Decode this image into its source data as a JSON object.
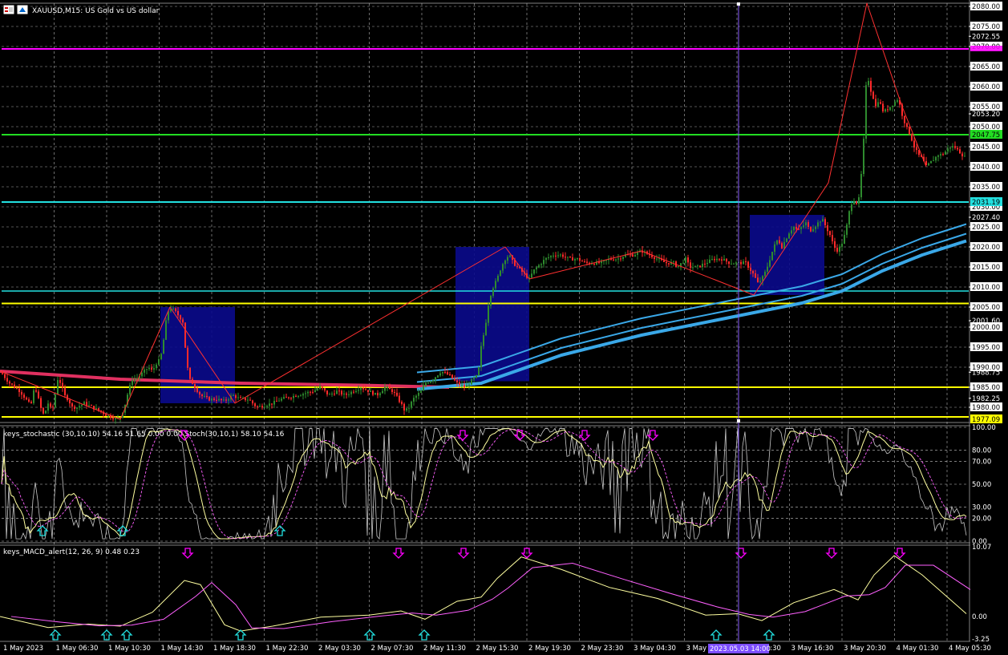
{
  "chart_window": {
    "title": "XAUUSD,M15:  US Gold vs US dollar",
    "symbol": "XAUUSD",
    "timeframe": "M15",
    "description": "US Gold vs US dollar"
  },
  "colors": {
    "background": "#000000",
    "grid": "#c8c8c8",
    "bull_candle": "#2e8b2e",
    "bear_candle": "#ff2a2a",
    "zigzag": "#ff3030",
    "zone": "#0a0a8c",
    "ma_slow": "#e03060",
    "ma_blue": "#3aa8e8",
    "level_magenta": "#ff00ff",
    "level_green": "#22dd22",
    "level_cyan": "#22e0e0",
    "level_yellow": "#ffff00",
    "stoch_main": "#c8c8c8",
    "stoch_signal": "#ffffa0",
    "stoch_dash": "#ff60ff",
    "macd_main": "#ffffa0",
    "macd_signal": "#ff60ff",
    "arrow_up": "#22e0e0",
    "arrow_down": "#ff00ff",
    "crosshair": "#8a5cff"
  },
  "price_axis": {
    "labels": [
      "2080.00",
      "2075.00",
      "2072.55",
      "2070.00",
      "2065.00",
      "2060.00",
      "2055.00",
      "2053.20",
      "2050.00",
      "2045.00",
      "2040.00",
      "2035.00",
      "2030.00",
      "2027.40",
      "2025.00",
      "2020.00",
      "2015.00",
      "2010.00",
      "2005.00",
      "2001.60",
      "2000.00",
      "1995.00",
      "1990.00",
      "1988.75",
      "1985.00",
      "1982.25",
      "1980.00"
    ],
    "current_price": "1977.09",
    "green_level_label": "2047.75",
    "cyan_level_label": "2031.19",
    "magenta_level": "2069.4",
    "yellow_level": "2005.9"
  },
  "stoch_panel": {
    "title": "keys_stochastic (30,10,10) 54.16 51.65 0.00 0.00  Stoch(30,10,1) 58.10 54.16",
    "levels": [
      "100.00",
      "80.00",
      "70.00",
      "50.00",
      "30.00",
      "20.00",
      "0.00"
    ]
  },
  "macd_panel": {
    "title": "keys_MACD_alert(12, 26, 9) 0.48 0.23",
    "levels": [
      "10.07",
      "0.00",
      "-3.25"
    ]
  },
  "time_axis": {
    "labels": [
      "1 May 2023",
      "1 May 06:30",
      "1 May 10:30",
      "1 May 14:30",
      "1 May 18:30",
      "1 May 22:30",
      "2 May 03:30",
      "2 May 07:30",
      "2 May 11:30",
      "2 May 15:30",
      "2 May 19:30",
      "2 May 23:30",
      "3 May 04:30",
      "3 May 08:30",
      "3 May 12:30",
      "3 May 16:30",
      "3 May 20:30",
      "4 May 01:30",
      "4 May 05:30"
    ],
    "crosshair_label": "2023.05.03 14:00"
  },
  "chart_data": {
    "type": "candlestick",
    "title": "XAUUSD,M15:  US Gold vs US dollar",
    "y_range": [
      1977.0,
      2080.8
    ],
    "path": [
      [
        0,
        1989
      ],
      [
        12,
        1986
      ],
      [
        25,
        1984
      ],
      [
        36,
        1981
      ],
      [
        38,
        1979
      ],
      [
        40,
        1983
      ],
      [
        44,
        1985
      ],
      [
        48,
        1982
      ],
      [
        52,
        1979
      ],
      [
        55,
        1978
      ],
      [
        60,
        1981
      ],
      [
        65,
        1979
      ],
      [
        68,
        1982
      ],
      [
        72,
        1987
      ],
      [
        76,
        1986
      ],
      [
        80,
        1983
      ],
      [
        85,
        1982
      ],
      [
        90,
        1980
      ],
      [
        96,
        1980
      ],
      [
        105,
        1981
      ],
      [
        115,
        1980
      ],
      [
        125,
        1979
      ],
      [
        133,
        1978
      ],
      [
        140,
        1977.5
      ],
      [
        145,
        1977
      ],
      [
        150,
        1977.5
      ],
      [
        155,
        1980
      ],
      [
        160,
        1984
      ],
      [
        165,
        1987
      ],
      [
        170,
        1987
      ],
      [
        175,
        1988
      ],
      [
        180,
        1989
      ],
      [
        185,
        1990
      ],
      [
        190,
        1989
      ],
      [
        195,
        1991
      ],
      [
        200,
        1992
      ],
      [
        205,
        1998
      ],
      [
        208,
        2003
      ],
      [
        212,
        2005
      ],
      [
        218,
        2004
      ],
      [
        222,
        2003
      ],
      [
        226,
        2002
      ],
      [
        229,
        2001
      ],
      [
        231,
        1995
      ],
      [
        233,
        1991
      ],
      [
        236,
        1987
      ],
      [
        240,
        1986
      ],
      [
        250,
        1983
      ],
      [
        260,
        1982
      ],
      [
        270,
        1982
      ],
      [
        280,
        1981.5
      ],
      [
        290,
        1983
      ],
      [
        300,
        1982
      ],
      [
        310,
        1982
      ],
      [
        320,
        1980
      ],
      [
        330,
        1980.5
      ],
      [
        340,
        1981
      ],
      [
        350,
        1982
      ],
      [
        360,
        1982.5
      ],
      [
        370,
        1983
      ],
      [
        380,
        1983.5
      ],
      [
        390,
        1984
      ],
      [
        400,
        1985
      ],
      [
        410,
        1983
      ],
      [
        420,
        1984
      ],
      [
        430,
        1983
      ],
      [
        440,
        1984
      ],
      [
        450,
        1985
      ],
      [
        460,
        1984
      ],
      [
        470,
        1983
      ],
      [
        480,
        1985
      ],
      [
        490,
        1984
      ],
      [
        500,
        1981
      ],
      [
        505,
        1979
      ],
      [
        510,
        1980
      ],
      [
        515,
        1982
      ],
      [
        520,
        1983
      ],
      [
        525,
        1984
      ],
      [
        530,
        1986
      ],
      [
        540,
        1987
      ],
      [
        550,
        1989
      ],
      [
        560,
        1988
      ],
      [
        570,
        1986
      ],
      [
        580,
        1985
      ],
      [
        590,
        1987
      ],
      [
        596,
        1988
      ],
      [
        600,
        1995
      ],
      [
        605,
        2000
      ],
      [
        610,
        2007
      ],
      [
        615,
        2010
      ],
      [
        620,
        2012
      ],
      [
        625,
        2015
      ],
      [
        630,
        2017
      ],
      [
        635,
        2018
      ],
      [
        640,
        2016
      ],
      [
        645,
        2015
      ],
      [
        650,
        2014
      ],
      [
        655,
        2013
      ],
      [
        660,
        2012
      ],
      [
        665,
        2014
      ],
      [
        670,
        2015
      ],
      [
        680,
        2017
      ],
      [
        690,
        2018
      ],
      [
        700,
        2018
      ],
      [
        710,
        2017
      ],
      [
        720,
        2017
      ],
      [
        730,
        2016
      ],
      [
        740,
        2016
      ],
      [
        750,
        2016
      ],
      [
        760,
        2017
      ],
      [
        770,
        2017
      ],
      [
        780,
        2018
      ],
      [
        790,
        2018
      ],
      [
        800,
        2019
      ],
      [
        810,
        2018
      ],
      [
        820,
        2017
      ],
      [
        830,
        2016
      ],
      [
        840,
        2016
      ],
      [
        845,
        2015
      ],
      [
        850,
        2016
      ],
      [
        855,
        2017
      ],
      [
        860,
        2015
      ],
      [
        870,
        2015
      ],
      [
        880,
        2016
      ],
      [
        890,
        2017
      ],
      [
        900,
        2017
      ],
      [
        910,
        2016
      ],
      [
        920,
        2016
      ],
      [
        930,
        2016
      ],
      [
        940,
        2013
      ],
      [
        945,
        2011
      ],
      [
        950,
        2012
      ],
      [
        955,
        2014
      ],
      [
        960,
        2017
      ],
      [
        965,
        2020
      ],
      [
        970,
        2022
      ],
      [
        975,
        2020
      ],
      [
        980,
        2022
      ],
      [
        985,
        2024
      ],
      [
        990,
        2025
      ],
      [
        995,
        2024
      ],
      [
        1000,
        2025
      ],
      [
        1005,
        2026
      ],
      [
        1010,
        2024
      ],
      [
        1015,
        2025
      ],
      [
        1020,
        2026
      ],
      [
        1025,
        2027
      ],
      [
        1030,
        2025
      ],
      [
        1035,
        2023
      ],
      [
        1040,
        2020
      ],
      [
        1045,
        2019
      ],
      [
        1050,
        2021
      ],
      [
        1055,
        2024
      ],
      [
        1058,
        2028
      ],
      [
        1062,
        2031
      ],
      [
        1066,
        2032
      ],
      [
        1070,
        2030
      ],
      [
        1075,
        2040
      ],
      [
        1078,
        2050
      ],
      [
        1081,
        2065
      ],
      [
        1084,
        2060
      ],
      [
        1088,
        2058
      ],
      [
        1092,
        2055
      ],
      [
        1096,
        2057
      ],
      [
        1100,
        2054
      ],
      [
        1105,
        2054
      ],
      [
        1110,
        2055
      ],
      [
        1115,
        2056
      ],
      [
        1120,
        2057
      ],
      [
        1125,
        2053
      ],
      [
        1130,
        2050
      ],
      [
        1135,
        2048
      ],
      [
        1140,
        2045
      ],
      [
        1145,
        2043
      ],
      [
        1150,
        2042
      ],
      [
        1155,
        2040
      ],
      [
        1160,
        2041
      ],
      [
        1165,
        2042
      ],
      [
        1170,
        2043
      ],
      [
        1175,
        2043
      ],
      [
        1180,
        2044
      ],
      [
        1185,
        2045
      ],
      [
        1190,
        2045
      ],
      [
        1195,
        2044
      ],
      [
        1200,
        2043
      ],
      [
        1205,
        2042
      ]
    ],
    "zigzag": [
      [
        0,
        1989
      ],
      [
        150,
        1977
      ],
      [
        212,
        2005
      ],
      [
        293,
        1981
      ],
      [
        630,
        2020
      ],
      [
        660,
        2012
      ],
      [
        800,
        2019
      ],
      [
        940,
        2008
      ],
      [
        1033,
        2036
      ],
      [
        1081,
        2080.8
      ],
      [
        1125,
        2055
      ],
      [
        1155,
        2040
      ]
    ],
    "zones": [
      [
        200,
        293,
        1981,
        2005
      ],
      [
        568,
        660,
        1986.5,
        2020
      ],
      [
        935,
        1028,
        2008,
        2028
      ]
    ],
    "ma_slow": [
      [
        0,
        1989
      ],
      [
        150,
        1987
      ],
      [
        300,
        1986
      ],
      [
        450,
        1985.5
      ],
      [
        560,
        1985
      ]
    ],
    "ma_blue": [
      [
        520,
        1984.5
      ],
      [
        600,
        1986
      ],
      [
        700,
        1993
      ],
      [
        800,
        1998
      ],
      [
        900,
        2002
      ],
      [
        1000,
        2006
      ],
      [
        1050,
        2009
      ],
      [
        1100,
        2014
      ],
      [
        1150,
        2018
      ],
      [
        1205,
        2021.5
      ]
    ],
    "levels": {
      "magenta": 2069.4,
      "green": 2048.0,
      "cyan": 2031.2,
      "cyan2": 2009.0,
      "yellow": 2005.9,
      "yellow2": 1985.0
    }
  }
}
